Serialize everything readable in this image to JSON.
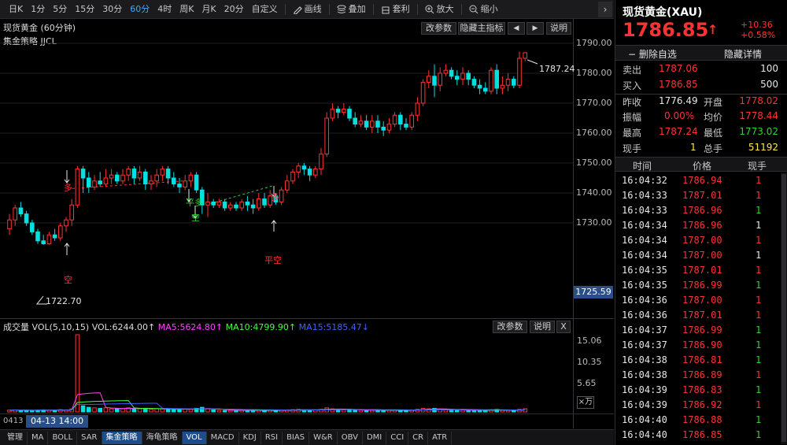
{
  "toolbar": {
    "periods": [
      "日K",
      "1分",
      "5分",
      "15分",
      "30分",
      "60分",
      "4时",
      "周K",
      "月K",
      "20分",
      "自定义"
    ],
    "active_period": "60分",
    "tools": [
      {
        "icon": "pen-icon",
        "label": "画线"
      },
      {
        "icon": "stack-icon",
        "label": "叠加"
      },
      {
        "icon": "arbitrage-icon",
        "label": "套利"
      },
      {
        "icon": "zoom-in-icon",
        "label": "放大"
      },
      {
        "icon": "zoom-out-icon",
        "label": "缩小"
      }
    ],
    "collapse_glyph": "›"
  },
  "chart": {
    "title": "现货黄金 (60分钟)",
    "strategy": "集金策略 JJCL",
    "buttons": {
      "params": "改参数",
      "hide_main": "隐藏主指标",
      "prev": "◀",
      "next": "▶",
      "help": "说明"
    },
    "last_price_tag": "1725.59",
    "low_label": "1722.70",
    "high_label": "1787.24",
    "signals": {
      "duo1": "多",
      "kong1": "空",
      "pingduo": "平多",
      "kong2": "空",
      "duo2": "多",
      "pingkong": "平空"
    },
    "time_cursor": "04-13 14:00",
    "x_axis_start": "0413"
  },
  "volume": {
    "label": "成交量",
    "params": "VOL(5,10,15)",
    "vol": "VOL:6244.00↑",
    "ma5": "MA5:5624.80↑",
    "ma10": "MA10:4799.90↑",
    "ma15": "MA15:5185.47↓",
    "buttons": {
      "params": "改参数",
      "help": "说明",
      "close": "X"
    },
    "unit": "×万",
    "ticks": [
      "15.06",
      "10.35",
      "5.65"
    ]
  },
  "colors": {
    "up": "#ff3232",
    "down": "#00e0e0",
    "ma5": "#ff40ff",
    "ma10": "#40ff40",
    "ma15": "#4060ff",
    "accent": "#4aa3ff"
  },
  "bottom_tabs": [
    "管理",
    "MA",
    "BOLL",
    "SAR",
    "集金策略",
    "海龟策略",
    "VOL",
    "MACD",
    "KDJ",
    "RSI",
    "BIAS",
    "W&R",
    "OBV",
    "DMI",
    "CCI",
    "CR",
    "ATR"
  ],
  "bottom_active": [
    "集金策略",
    "VOL"
  ],
  "quote": {
    "name": "现货黄金(XAU)",
    "price": "1786.85",
    "arrow": "↑",
    "change": "+10.36",
    "change_pct": "+0.58%",
    "delete_watch": "− 删除自选",
    "hide_detail": "隐藏详情",
    "sell_label": "卖出",
    "sell_price": "1787.06",
    "sell_vol": "100",
    "buy_label": "买入",
    "buy_price": "1786.85",
    "buy_vol": "500",
    "prev_close_label": "昨收",
    "prev_close": "1776.49",
    "open_label": "开盘",
    "open": "1778.02",
    "amplitude_label": "振幅",
    "amplitude": "0.00%",
    "avg_label": "均价",
    "avg": "1778.44",
    "high_label": "最高",
    "high": "1787.24",
    "low_label": "最低",
    "low": "1773.02",
    "cur_vol_label": "现手",
    "cur_vol": "1",
    "total_vol_label": "总手",
    "total_vol": "51192"
  },
  "ticks_header": {
    "time": "时间",
    "price": "价格",
    "vol": "现手"
  },
  "tick_rows": [
    {
      "time": "16:04:32",
      "price": "1786.94",
      "vol": "1",
      "vc": "red"
    },
    {
      "time": "16:04:33",
      "price": "1787.01",
      "vol": "1",
      "vc": "red"
    },
    {
      "time": "16:04:33",
      "price": "1786.96",
      "vol": "1",
      "vc": "green"
    },
    {
      "time": "16:04:34",
      "price": "1786.96",
      "vol": "1",
      "vc": "white"
    },
    {
      "time": "16:04:34",
      "price": "1787.00",
      "vol": "1",
      "vc": "red"
    },
    {
      "time": "16:04:34",
      "price": "1787.00",
      "vol": "1",
      "vc": "white"
    },
    {
      "time": "16:04:35",
      "price": "1787.01",
      "vol": "1",
      "vc": "red"
    },
    {
      "time": "16:04:35",
      "price": "1786.99",
      "vol": "1",
      "vc": "green"
    },
    {
      "time": "16:04:36",
      "price": "1787.00",
      "vol": "1",
      "vc": "red"
    },
    {
      "time": "16:04:36",
      "price": "1787.01",
      "vol": "1",
      "vc": "red"
    },
    {
      "time": "16:04:37",
      "price": "1786.99",
      "vol": "1",
      "vc": "green"
    },
    {
      "time": "16:04:37",
      "price": "1786.90",
      "vol": "1",
      "vc": "green"
    },
    {
      "time": "16:04:38",
      "price": "1786.81",
      "vol": "1",
      "vc": "green"
    },
    {
      "time": "16:04:38",
      "price": "1786.89",
      "vol": "1",
      "vc": "red"
    },
    {
      "time": "16:04:39",
      "price": "1786.83",
      "vol": "1",
      "vc": "green"
    },
    {
      "time": "16:04:39",
      "price": "1786.92",
      "vol": "1",
      "vc": "red"
    },
    {
      "time": "16:04:40",
      "price": "1786.88",
      "vol": "1",
      "vc": "green"
    },
    {
      "time": "16:04:40",
      "price": "1786.85",
      "vol": "1",
      "vc": "green"
    }
  ],
  "chart_data": {
    "type": "candlestick",
    "price_axis_ticks": [
      1790,
      1780,
      1770,
      1760,
      1750,
      1740,
      1730
    ],
    "candles": [
      [
        1728,
        1731,
        1726,
        1733
      ],
      [
        1731,
        1735,
        1729,
        1736
      ],
      [
        1735,
        1733,
        1732,
        1737
      ],
      [
        1733,
        1730,
        1729,
        1734
      ],
      [
        1730,
        1727,
        1726,
        1731
      ],
      [
        1727,
        1724,
        1723,
        1728
      ],
      [
        1724,
        1723,
        1722.7,
        1726
      ],
      [
        1723,
        1726,
        1722.7,
        1727
      ],
      [
        1726,
        1725,
        1724,
        1728
      ],
      [
        1725,
        1729,
        1724,
        1730
      ],
      [
        1729,
        1731,
        1727,
        1732
      ],
      [
        1731,
        1736,
        1729,
        1738
      ],
      [
        1736,
        1748,
        1735,
        1749
      ],
      [
        1748,
        1745,
        1740,
        1749
      ],
      [
        1745,
        1742,
        1740,
        1747
      ],
      [
        1742,
        1744,
        1741,
        1746
      ],
      [
        1744,
        1743,
        1742,
        1747
      ],
      [
        1743,
        1745,
        1742,
        1748
      ],
      [
        1745,
        1746,
        1743,
        1748
      ],
      [
        1746,
        1744,
        1743,
        1747
      ],
      [
        1744,
        1746,
        1743,
        1748
      ],
      [
        1746,
        1748,
        1744,
        1749
      ],
      [
        1748,
        1745,
        1743,
        1749
      ],
      [
        1745,
        1747,
        1744,
        1749
      ],
      [
        1747,
        1743,
        1741,
        1748
      ],
      [
        1743,
        1744,
        1741,
        1746
      ],
      [
        1744,
        1746,
        1742,
        1748
      ],
      [
        1746,
        1748,
        1744,
        1749
      ],
      [
        1748,
        1745,
        1743,
        1749
      ],
      [
        1745,
        1743,
        1742,
        1747
      ],
      [
        1743,
        1742,
        1740,
        1745
      ],
      [
        1742,
        1744,
        1741,
        1746
      ],
      [
        1744,
        1746,
        1742,
        1747
      ],
      [
        1746,
        1741,
        1740,
        1747
      ],
      [
        1741,
        1736,
        1733,
        1742
      ],
      [
        1736,
        1737,
        1732,
        1740
      ],
      [
        1737,
        1736,
        1735,
        1738
      ],
      [
        1736,
        1737,
        1735,
        1738
      ],
      [
        1737,
        1735,
        1734,
        1738
      ],
      [
        1735,
        1736,
        1734,
        1737
      ],
      [
        1736,
        1735,
        1734,
        1737
      ],
      [
        1735,
        1737,
        1734,
        1738
      ],
      [
        1737,
        1736,
        1734,
        1739
      ],
      [
        1736,
        1735,
        1733,
        1738
      ],
      [
        1735,
        1738,
        1734,
        1740
      ],
      [
        1738,
        1736,
        1735,
        1740
      ],
      [
        1736,
        1739,
        1735,
        1741
      ],
      [
        1739,
        1737,
        1736,
        1740
      ],
      [
        1737,
        1741,
        1736,
        1742
      ],
      [
        1741,
        1744,
        1740,
        1746
      ],
      [
        1744,
        1747,
        1743,
        1748
      ],
      [
        1747,
        1749,
        1745,
        1750
      ],
      [
        1749,
        1748,
        1746,
        1750
      ],
      [
        1748,
        1746,
        1744,
        1749
      ],
      [
        1746,
        1748,
        1745,
        1749
      ],
      [
        1748,
        1753,
        1746,
        1755
      ],
      [
        1753,
        1765,
        1752,
        1767
      ],
      [
        1765,
        1768,
        1764,
        1770
      ],
      [
        1768,
        1767,
        1765,
        1769
      ],
      [
        1767,
        1768,
        1766,
        1770
      ],
      [
        1768,
        1765,
        1764,
        1769
      ],
      [
        1765,
        1763,
        1762,
        1767
      ],
      [
        1763,
        1764,
        1762,
        1766
      ],
      [
        1764,
        1762,
        1761,
        1766
      ],
      [
        1762,
        1764,
        1760,
        1766
      ],
      [
        1764,
        1762,
        1760,
        1766
      ],
      [
        1762,
        1761,
        1759,
        1764
      ],
      [
        1761,
        1763,
        1760,
        1765
      ],
      [
        1763,
        1766,
        1762,
        1767
      ],
      [
        1766,
        1763,
        1761,
        1767
      ],
      [
        1763,
        1762,
        1761,
        1765
      ],
      [
        1762,
        1766,
        1761,
        1767
      ],
      [
        1766,
        1770,
        1764,
        1772
      ],
      [
        1770,
        1777,
        1769,
        1778
      ],
      [
        1777,
        1779,
        1775,
        1781
      ],
      [
        1779,
        1776,
        1772,
        1783
      ],
      [
        1776,
        1780,
        1774,
        1782
      ],
      [
        1780,
        1781,
        1779,
        1783
      ],
      [
        1781,
        1779,
        1778,
        1782
      ],
      [
        1779,
        1778,
        1776,
        1781
      ],
      [
        1778,
        1780,
        1776,
        1782
      ],
      [
        1780,
        1778,
        1776,
        1781
      ],
      [
        1778,
        1776,
        1775,
        1779
      ],
      [
        1776,
        1775,
        1773,
        1778
      ],
      [
        1775,
        1774,
        1773,
        1777
      ],
      [
        1774,
        1781,
        1773,
        1782
      ],
      [
        1781,
        1775,
        1773,
        1783
      ],
      [
        1775,
        1776,
        1773,
        1779
      ],
      [
        1776,
        1778,
        1774,
        1780
      ],
      [
        1778,
        1776,
        1775,
        1779
      ],
      [
        1776,
        1785,
        1775,
        1787.24
      ],
      [
        1785,
        1786.85,
        1784,
        1787
      ]
    ],
    "volumes": [
      0.35,
      0.4,
      0.3,
      0.3,
      0.3,
      0.35,
      0.4,
      0.35,
      0.3,
      0.45,
      0.4,
      0.6,
      15.06,
      1.2,
      0.9,
      0.8,
      0.7,
      0.8,
      0.6,
      0.7,
      0.6,
      0.8,
      0.7,
      0.6,
      0.7,
      0.5,
      0.6,
      0.6,
      0.5,
      0.5,
      0.5,
      0.6,
      0.5,
      0.7,
      0.9,
      0.6,
      0.4,
      0.3,
      0.3,
      0.3,
      0.3,
      0.3,
      0.3,
      0.3,
      0.35,
      0.3,
      0.35,
      0.3,
      0.4,
      0.4,
      0.45,
      0.5,
      0.4,
      0.4,
      0.4,
      0.5,
      0.8,
      0.6,
      0.5,
      0.4,
      0.4,
      0.4,
      0.35,
      0.35,
      0.3,
      0.3,
      0.3,
      0.35,
      0.4,
      0.3,
      0.3,
      0.4,
      0.5,
      0.7,
      0.6,
      0.7,
      0.5,
      0.4,
      0.4,
      0.35,
      0.35,
      0.3,
      0.3,
      0.3,
      0.3,
      0.4,
      0.5,
      0.35,
      0.3,
      0.3,
      0.5,
      0.62
    ]
  }
}
